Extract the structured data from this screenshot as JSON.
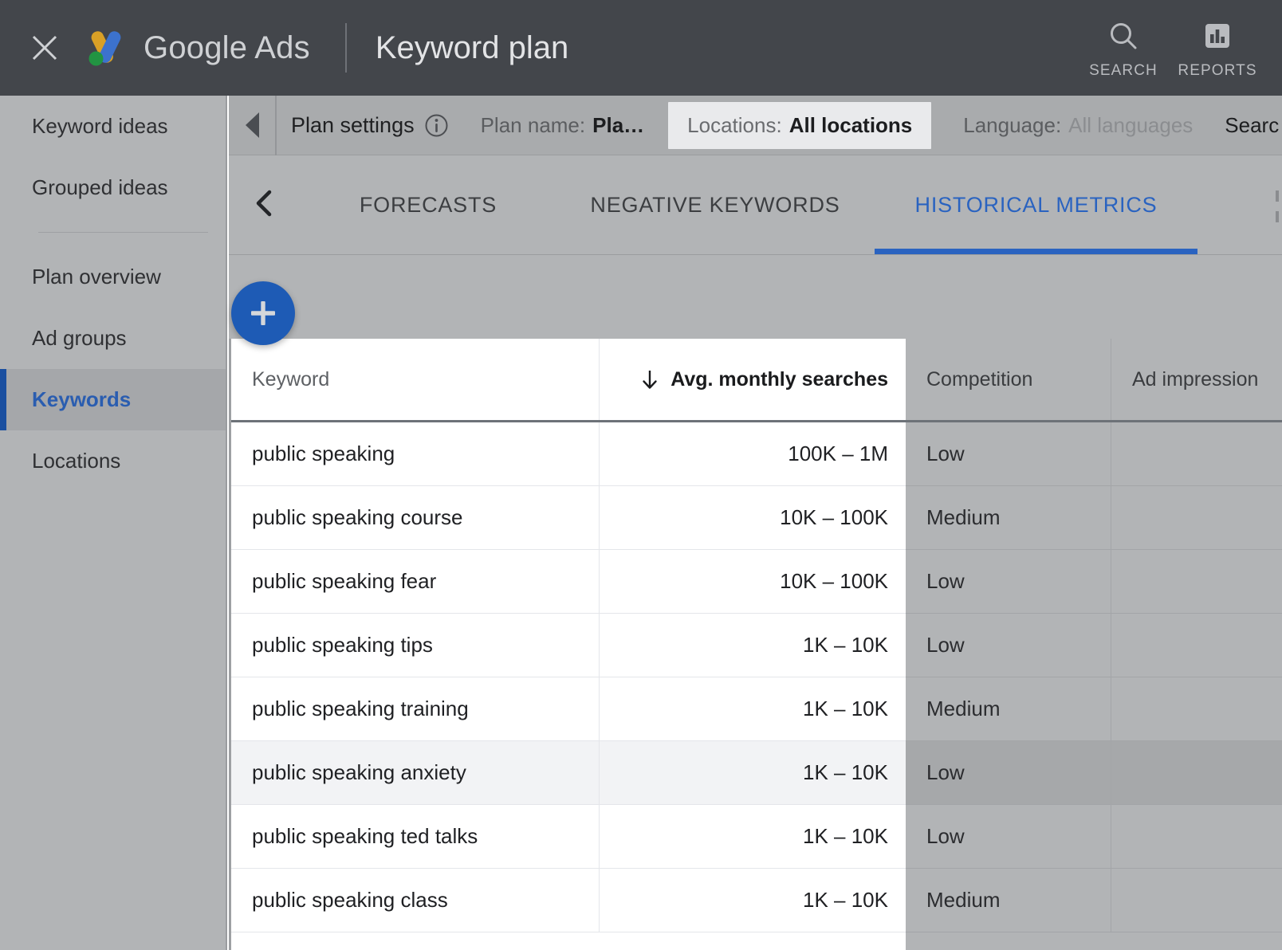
{
  "appbar": {
    "close_icon": "close-icon",
    "logo_icon": "google-ads-logo",
    "brand": "Google Ads",
    "page_title": "Keyword plan",
    "actions": [
      {
        "icon": "search-icon",
        "label": "SEARCH"
      },
      {
        "icon": "reports-bar-chart-icon",
        "label": "REPORTS"
      }
    ]
  },
  "sidebar": {
    "items": [
      {
        "label": "Keyword ideas",
        "active": false
      },
      {
        "label": "Grouped ideas",
        "active": false
      },
      {
        "label": "Plan overview",
        "active": false
      },
      {
        "label": "Ad groups",
        "active": false
      },
      {
        "label": "Keywords",
        "active": true
      },
      {
        "label": "Locations",
        "active": false
      }
    ],
    "divider_after_index": 1
  },
  "settings_bar": {
    "collapse_icon": "triangle-left-icon",
    "title": "Plan settings",
    "info_icon": "info-circle-icon",
    "chips": [
      {
        "key": "Plan name:",
        "value": "Pla…",
        "muted": false,
        "highlight": false
      },
      {
        "key": "Locations:",
        "value": "All locations",
        "muted": false,
        "highlight": true
      },
      {
        "key": "Language:",
        "value": "All languages",
        "muted": true,
        "highlight": false
      }
    ],
    "clipped_chip": "Searc"
  },
  "tabs": {
    "back_icon": "chevron-left-icon",
    "items": [
      {
        "label": "FORECASTS",
        "active": false
      },
      {
        "label": "NEGATIVE KEYWORDS",
        "active": false
      },
      {
        "label": "HISTORICAL METRICS",
        "active": true
      }
    ]
  },
  "fab": {
    "icon": "plus-icon",
    "label": "+"
  },
  "table": {
    "columns": [
      {
        "label": "Keyword",
        "sorted": false
      },
      {
        "label": "Avg. monthly searches",
        "sorted": true,
        "sort_icon": "arrow-down-icon"
      },
      {
        "label": "Competition",
        "sorted": false
      },
      {
        "label": "Ad impression",
        "sorted": false
      }
    ],
    "rows": [
      {
        "keyword": "public speaking",
        "searches": "100K – 1M",
        "competition": "Low",
        "ad_impression": "",
        "hover": false
      },
      {
        "keyword": "public speaking course",
        "searches": "10K – 100K",
        "competition": "Medium",
        "ad_impression": "",
        "hover": false
      },
      {
        "keyword": "public speaking fear",
        "searches": "10K – 100K",
        "competition": "Low",
        "ad_impression": "",
        "hover": false
      },
      {
        "keyword": "public speaking tips",
        "searches": "1K – 10K",
        "competition": "Low",
        "ad_impression": "",
        "hover": false
      },
      {
        "keyword": "public speaking training",
        "searches": "1K – 10K",
        "competition": "Medium",
        "ad_impression": "",
        "hover": false
      },
      {
        "keyword": "public speaking anxiety",
        "searches": "1K – 10K",
        "competition": "Low",
        "ad_impression": "",
        "hover": true
      },
      {
        "keyword": "public speaking ted talks",
        "searches": "1K – 10K",
        "competition": "Low",
        "ad_impression": "",
        "hover": false
      },
      {
        "keyword": "public speaking class",
        "searches": "1K – 10K",
        "competition": "Medium",
        "ad_impression": "",
        "hover": false
      }
    ]
  },
  "colors": {
    "appbar_bg": "#43464b",
    "accent_blue": "#2a63c0",
    "fab_blue": "#1e5bb5",
    "active_rail": "#1a4fa0",
    "dim_overlay": "#b2b4b6",
    "panel_white": "#ffffff",
    "row_hover": "#f2f3f5",
    "logo_yellow": "#d9a026",
    "logo_blue": "#3c72cd",
    "logo_green": "#229442"
  }
}
